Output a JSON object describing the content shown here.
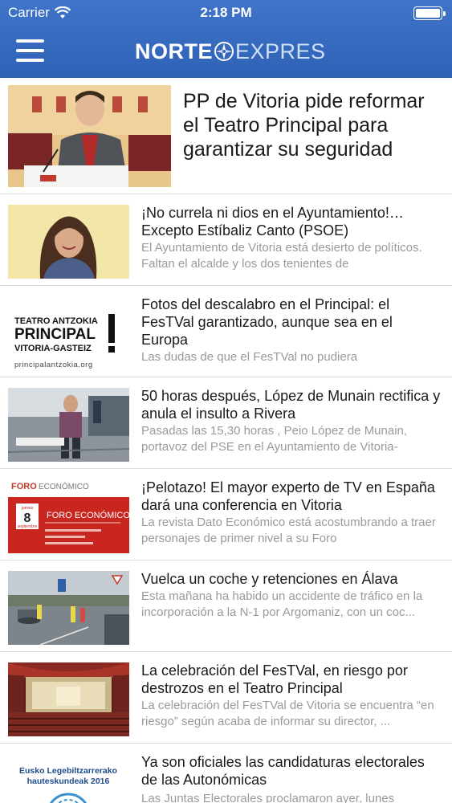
{
  "status_bar": {
    "carrier": "Carrier",
    "time": "2:18 PM"
  },
  "header": {
    "logo_part1": "NORTE",
    "logo_part2": "EXPRES"
  },
  "articles": [
    {
      "headline": "PP de Vitoria pide reformar el Teatro Principal para garantizar su seguridad",
      "summary": ""
    },
    {
      "headline": "¡No currela ni dios en el Ayuntamiento!… Excepto Estíbaliz Canto (PSOE)",
      "summary": "El Ayuntamiento de Vitoria está desierto de políticos. Faltan el alcalde y los dos tenientes de"
    },
    {
      "headline": "Fotos del descalabro en el Principal: el FesTVal garantizado, aunque sea en el Europa",
      "summary": "Las dudas de que el FesTVal no pudiera"
    },
    {
      "headline": "50 horas después, López de Munain rectifica y anula el insulto a Rivera",
      "summary": "Pasadas las 15,30 horas , Peio López de Munain, portavoz del PSE en el Ayuntamiento de Vitoria-"
    },
    {
      "headline": "¡Pelotazo! El mayor experto de TV en España dará una conferencia en Vitoria",
      "summary": "La revista Dato Económico está acostumbrando a traer personajes de primer nivel a su Foro"
    },
    {
      "headline": "Vuelca un coche y retenciones en Álava",
      "summary": "Esta mañana ha habido un accidente de tráfico en la incorporación a la N-1 por Argomaniz, con un coc..."
    },
    {
      "headline": "La celebración del FesTVal, en riesgo por destrozos en el Teatro Principal",
      "summary": "La celebración del FesTVal de Vitoria se encuentra “en riesgo” según acaba de informar su director, ..."
    },
    {
      "headline": "Ya son oficiales las candidaturas electorales de las Autonómicas",
      "summary": "Las Juntas Electorales proclamaron ayer, lunes"
    }
  ],
  "thumbnails": {
    "teatro": {
      "line1": "TEATRO ANTZOKIA",
      "line2": "PRINCIPAL",
      "line3": "VITORIA-GASTEIZ",
      "line4": "principalantzokia.org"
    },
    "foro": {
      "title": "FORO",
      "subtitle": "ECONÓMICO",
      "day_label": "jueves",
      "day": "8",
      "month": "septiembre",
      "banner": "FORO ECONÓMICO"
    },
    "elections": {
      "line1": "Eusko Legebiltzarrerako",
      "line2": "hauteskundeak 2016"
    }
  },
  "colors": {
    "header_blue": "#3568bd",
    "headline": "#1a1a1a",
    "summary": "#9a9a9a",
    "divider": "#dcdcdc"
  }
}
